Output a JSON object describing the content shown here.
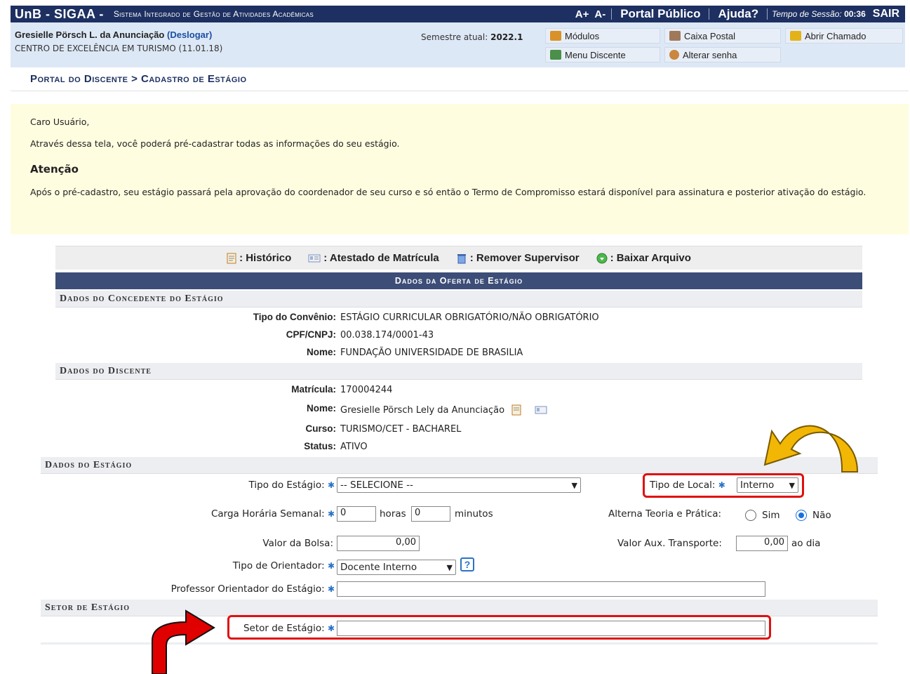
{
  "topbar": {
    "brand": "UnB - SIGAA -",
    "system_name": "Sistema Integrado de Gestão de Atividades Acadêmicas",
    "font_plus": "A+",
    "font_minus": "A-",
    "portal_publico": "Portal Público",
    "ajuda": "Ajuda?",
    "session_label": "Tempo de Sessão:",
    "session_time": "00:36",
    "sair": "SAIR"
  },
  "user": {
    "name": "Gresielle Pörsch L. da Anunciação",
    "logout": "(Deslogar)",
    "unit": "CENTRO DE EXCELÊNCIA EM TURISMO (11.01.18)",
    "semester_label": "Semestre atual:",
    "semester": "2022.1"
  },
  "menu": {
    "modulos": "Módulos",
    "caixa_postal": "Caixa Postal",
    "abrir_chamado": "Abrir Chamado",
    "menu_discente": "Menu Discente",
    "alterar_senha": "Alterar senha"
  },
  "breadcrumb": "Portal do Discente > Cadastro de Estágio",
  "info": {
    "greeting": "Caro Usuário,",
    "line1": "Através dessa tela, você poderá pré-cadastrar todas as informações do seu estágio.",
    "attention": "Atenção",
    "line2": "Após o pré-cadastro, seu estágio passará pela aprovação do coordenador de seu curso e só então o Termo de Compromisso estará disponível para assinatura e posterior ativação do estágio."
  },
  "icons_legend": {
    "historico": ": Histórico",
    "atestado": ": Atestado de Matrícula",
    "remover": ": Remover Supervisor",
    "baixar": ": Baixar Arquivo"
  },
  "caption": "Dados da Oferta de Estágio",
  "concedente": {
    "title": "Dados do Concedente do Estágio",
    "tipo_convenio_label": "Tipo do Convênio:",
    "tipo_convenio": "ESTÁGIO CURRICULAR OBRIGATÓRIO/NÃO OBRIGATÓRIO",
    "cpf_label": "CPF/CNPJ:",
    "cpf": "00.038.174/0001-43",
    "nome_label": "Nome:",
    "nome": "FUNDAÇÃO UNIVERSIDADE DE BRASILIA"
  },
  "discente": {
    "title": "Dados do Discente",
    "matricula_label": "Matrícula:",
    "matricula": "170004244",
    "nome_label": "Nome:",
    "nome": "Gresielle Pörsch Lely da Anunciação",
    "curso_label": "Curso:",
    "curso": "TURISMO/CET - BACHAREL",
    "status_label": "Status:",
    "status": "ATIVO"
  },
  "estagio": {
    "title": "Dados do Estágio",
    "tipo_estagio_label": "Tipo do Estágio:",
    "tipo_estagio_value": "-- SELECIONE --",
    "tipo_local_label": "Tipo de Local:",
    "tipo_local_value": "Interno",
    "carga_label": "Carga Horária Semanal:",
    "horas_value": "0",
    "horas_unit": "horas",
    "minutos_value": "0",
    "minutos_unit": "minutos",
    "alterna_label": "Alterna Teoria e Prática:",
    "alterna_sim": "Sim",
    "alterna_nao": "Não",
    "bolsa_label": "Valor da Bolsa:",
    "bolsa_value": "0,00",
    "transporte_label": "Valor Aux. Transporte:",
    "transporte_value": "0,00",
    "transporte_unit": "ao dia",
    "orientador_tipo_label": "Tipo de Orientador:",
    "orientador_tipo_value": "Docente Interno",
    "professor_label": "Professor Orientador do Estágio:",
    "professor_value": ""
  },
  "setor": {
    "title": "Setor de Estágio",
    "label": "Setor de Estágio:",
    "value": ""
  },
  "colors": {
    "navy": "#1d3061",
    "caption": "#3c4d77",
    "highlight_box": "#e01010",
    "arrow_yellow": "#f2b705",
    "arrow_red": "#e00000"
  }
}
